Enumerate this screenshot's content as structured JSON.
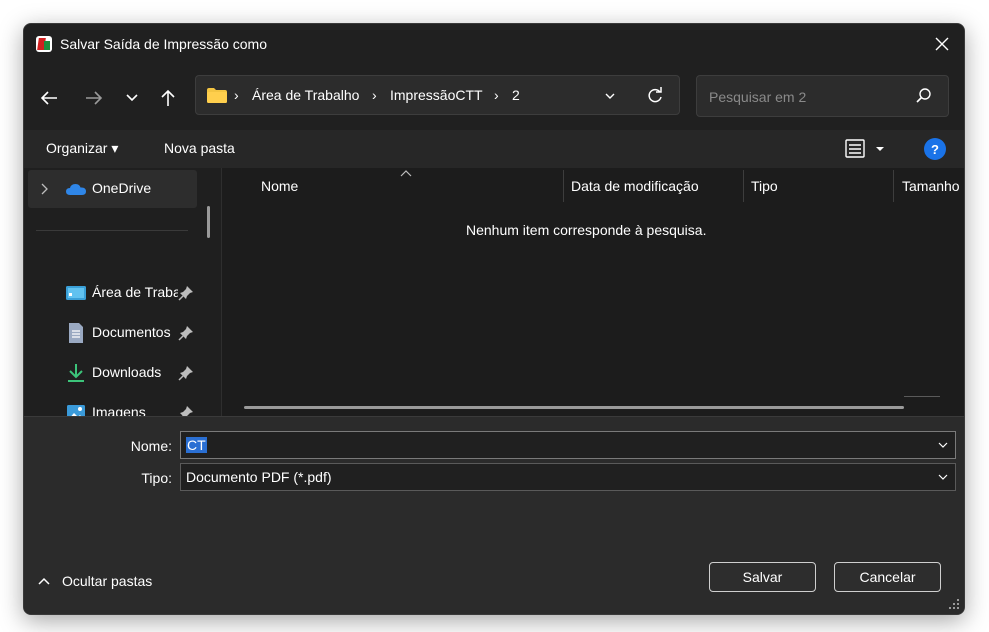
{
  "window": {
    "title": "Salvar Saída de Impressão como",
    "icon": "app-icon"
  },
  "nav": {
    "back_icon": "arrow-left-icon",
    "forward_icon": "arrow-right-icon",
    "recent_icon": "chevron-down-icon",
    "up_icon": "arrow-up-icon"
  },
  "address": {
    "breadcrumbs": [
      "Área de Trabalho",
      "ImpressãoCTT",
      "2"
    ],
    "separator": "›"
  },
  "search": {
    "placeholder": "Pesquisar em 2"
  },
  "toolbar": {
    "organize_label": "Organizar ▾",
    "new_folder_label": "Nova pasta",
    "help_label": "?"
  },
  "sidebar": {
    "top_item": "OneDrive",
    "items": [
      {
        "label": "Área de Trabalho",
        "icon": "desktop-icon"
      },
      {
        "label": "Documentos",
        "icon": "documents-icon"
      },
      {
        "label": "Downloads",
        "icon": "downloads-icon"
      },
      {
        "label": "Imagens",
        "icon": "pictures-icon"
      }
    ]
  },
  "file_list": {
    "columns": [
      "Nome",
      "Data de modificação",
      "Tipo",
      "Tamanho"
    ],
    "empty_message": "Nenhum item corresponde à pesquisa."
  },
  "form": {
    "name_label": "Nome:",
    "name_value": "CT",
    "type_label": "Tipo:",
    "type_value": "Documento PDF (*.pdf)"
  },
  "footer": {
    "hide_folders_label": "Ocultar pastas",
    "save_label": "Salvar",
    "cancel_label": "Cancelar"
  },
  "colors": {
    "background": "#202020",
    "accent": "#2a6fd3",
    "help_blue": "#1a73e8",
    "folder_yellow": "#f4c542",
    "onedrive_blue": "#2f86e8"
  }
}
